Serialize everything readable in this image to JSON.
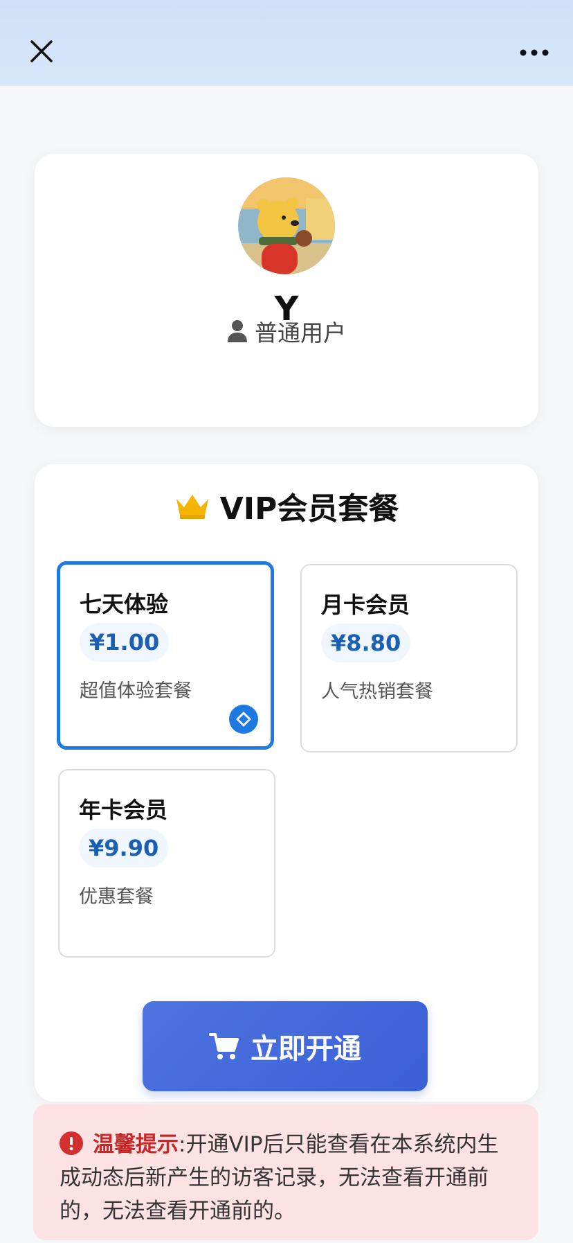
{
  "topbar": {
    "close_icon": "close-icon",
    "more_icon": "more-horizontal-icon"
  },
  "profile": {
    "avatar_icon": "avatar-bear-illustration",
    "username": "Y",
    "role_icon": "user-icon",
    "role": "普通用户"
  },
  "vip": {
    "title_icon": "crown-icon",
    "title": "VIP会员套餐",
    "plans": [
      {
        "name": "七天体验",
        "price": "¥1.00",
        "desc": "超值体验套餐",
        "selected": true
      },
      {
        "name": "月卡会员",
        "price": "¥8.80",
        "desc": "人气热销套餐",
        "selected": false
      },
      {
        "name": "年卡会员",
        "price": "¥9.90",
        "desc": "优惠套餐",
        "selected": false
      }
    ],
    "buy_icon": "cart-icon",
    "buy_label": "立即开通"
  },
  "notice": {
    "icon": "alert-icon",
    "label": "温馨提示",
    "colon": ":",
    "text": "开通VIP后只能查看在本系统内生成动态后新产生的访客记录，无法查看开通前的，无法查看开通前的。"
  },
  "colors": {
    "accent": "#1e7ae0",
    "button": "#3a5fd6",
    "price": "#1b5fb5",
    "notice_bg": "#fde2e4",
    "notice_label": "#c62828",
    "crown": "#f4b400"
  }
}
